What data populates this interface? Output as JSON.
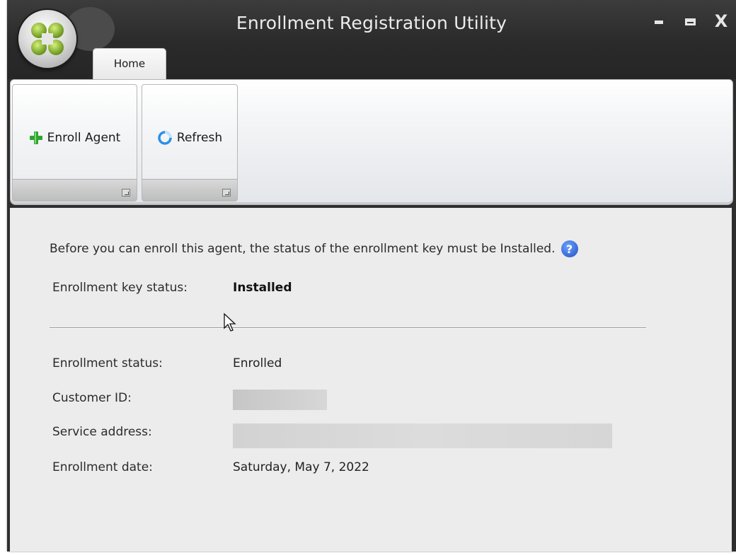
{
  "window": {
    "title": "Enrollment Registration Utility",
    "controls": {
      "minimize": "minimize-icon",
      "maximize": "maximize-icon",
      "close": "X"
    }
  },
  "app_orb": {
    "icon": "app-logo-icon"
  },
  "tabs": [
    {
      "label": "Home",
      "active": true
    }
  ],
  "ribbon": {
    "buttons": [
      {
        "label": "Enroll Agent",
        "icon": "green-plus-icon"
      },
      {
        "label": "Refresh",
        "icon": "refresh-icon"
      }
    ]
  },
  "content": {
    "info_text": "Before you can enroll this agent, the status of the enrollment key must be Installed.",
    "help_icon_text": "?",
    "key_status": {
      "label": "Enrollment key status:",
      "value": "Installed"
    },
    "details": [
      {
        "label": "Enrollment status:",
        "value": "Enrolled"
      },
      {
        "label": "Customer ID:",
        "value": "",
        "redacted": true
      },
      {
        "label": "Service address:",
        "value": "",
        "redacted": true
      },
      {
        "label": "Enrollment date:",
        "value": "Saturday, May 7, 2022"
      }
    ]
  },
  "colors": {
    "titlebar": "#2e2e2e",
    "content_bg": "#ececec",
    "accent_plus": "#2fa52f",
    "help_blue": "#2a5bd7"
  }
}
